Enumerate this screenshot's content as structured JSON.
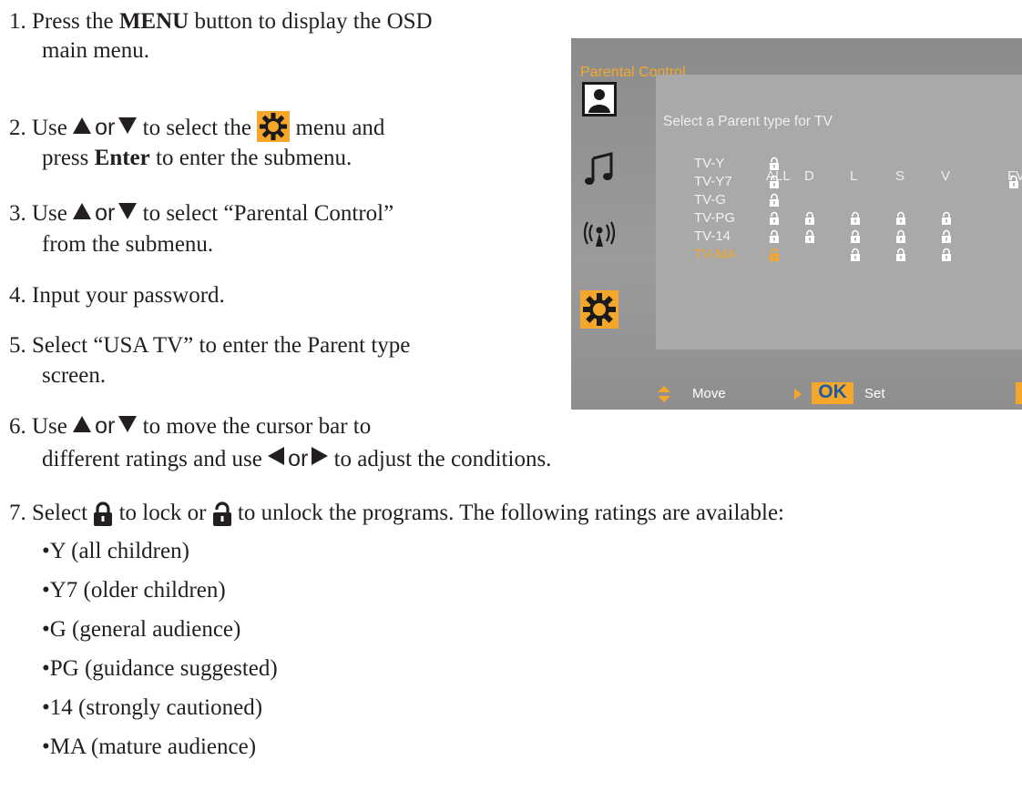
{
  "steps": {
    "s1_prefix": "1. Press the ",
    "s1_bold": "MENU",
    "s1_suffix": " button to display the OSD",
    "s1_line2": "main menu.",
    "s2_prefix": "2. Use ",
    "s2_or": "or",
    "s2_mid": " to select the ",
    "s2_suffix": " menu and",
    "s2_line2_prefix": "press ",
    "s2_line2_bold": "Enter",
    "s2_line2_suffix": " to enter the submenu.",
    "s3_prefix": "3. Use ",
    "s3_or": "or",
    "s3_suffix": " to select  “Parental Control”",
    "s3_line2": "from the submenu.",
    "s4": "4. Input your password.",
    "s5": "5. Select “USA TV” to enter the Parent type",
    "s5_line2": "screen.",
    "s6_prefix": "6. Use ",
    "s6_or": "or",
    "s6_suffix": " to move the cursor bar to",
    "s6_line2_prefix": "different ratings and use ",
    "s6_line2_or": "or",
    "s6_line2_suffix": " to adjust the conditions.",
    "s7_prefix": "7. Select ",
    "s7_mid": " to lock or ",
    "s7_suffix": " to unlock the programs. The following ratings are available:"
  },
  "ratings_list": [
    "•Y (all children)",
    "•Y7 (older children)",
    "•G (general audience)",
    "•PG (guidance suggested)",
    "•14 (strongly cautioned)",
    "•MA (mature audience)"
  ],
  "osd": {
    "title": "Parental Control",
    "subtitle": "Select a Parent type for TV",
    "columns": [
      "ALL",
      "D",
      "L",
      "S",
      "V",
      "FV"
    ],
    "rows": [
      "TV-Y",
      "TV-Y7",
      "TV-G",
      "TV-PG",
      "TV-14",
      "TV-MA"
    ],
    "selected_row": "TV-MA",
    "footer_move": "Move",
    "footer_ok": "OK",
    "footer_set": "Set",
    "sidebar_icons": [
      "picture-icon",
      "music-note-icon",
      "antenna-icon",
      "gear-icon"
    ]
  },
  "colors": {
    "accent": "#f4a72a",
    "osd_bg": "#959494",
    "osd_panel": "#a9a9a9",
    "text": "#231f20"
  }
}
